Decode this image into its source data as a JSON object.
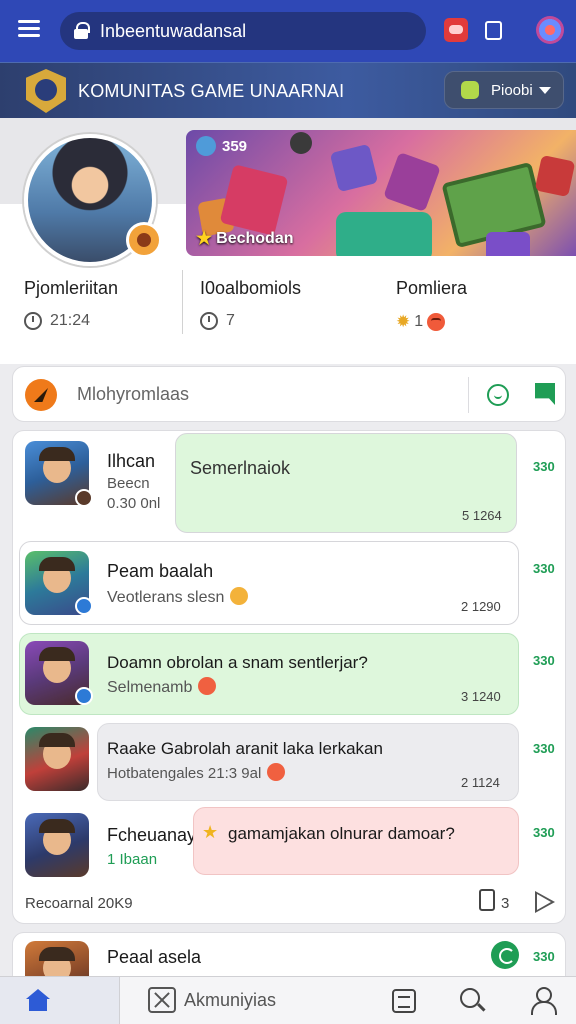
{
  "browser": {
    "url": "Inbeentuwadansal"
  },
  "community": {
    "title": "KOMUNITAS GAME UNAARNAI",
    "user_chip_label": "Pioobi"
  },
  "profile": {
    "banner_badge_count": "359",
    "banner_label": "Bechodan",
    "stats": [
      {
        "label": "Pjomleriitan",
        "value": "21:24"
      },
      {
        "label": "I0oalbomiols",
        "value": "7"
      },
      {
        "label": "Pomliera",
        "value": "1"
      }
    ]
  },
  "search": {
    "placeholder": "Mlohyromlaas"
  },
  "chats": [
    {
      "name": "Ilhcan",
      "sub1": "Beecn",
      "sub2": "0.30 0nl",
      "bubble": "Semerlnaiok",
      "time": "5 1264",
      "side": "330"
    },
    {
      "name": "Peam baalah",
      "sub": "Veotlerans slesn",
      "time": "2 1290",
      "side": "330"
    },
    {
      "name": "Doamn obrolan a snam sentlerjar?",
      "sub": "Selmenamb",
      "time": "3 1240",
      "side": "330"
    },
    {
      "name": "Raake Gabrolah aranit laka lerkakan",
      "sub": "Hotbatengales 21:3 9al",
      "time": "2 1124",
      "side": "330"
    },
    {
      "name": "Fcheuanay",
      "sub": "1 Ibaan",
      "bubble": "gamamjakan olnurar damoar?",
      "side": "330"
    }
  ],
  "panel_footer": {
    "text": "Recoarnal 20K9",
    "count": "3"
  },
  "last_chat": {
    "name": "Peaal asela",
    "side": "330"
  },
  "bottom_nav": {
    "community_label": "Akmuniyias"
  },
  "colors": {
    "header_blue": "#2f48b6",
    "accent_green": "#1f9d55",
    "green_bubble": "#def7dc",
    "red_bubble": "#fde0e0",
    "gray_bubble": "#ececef"
  }
}
